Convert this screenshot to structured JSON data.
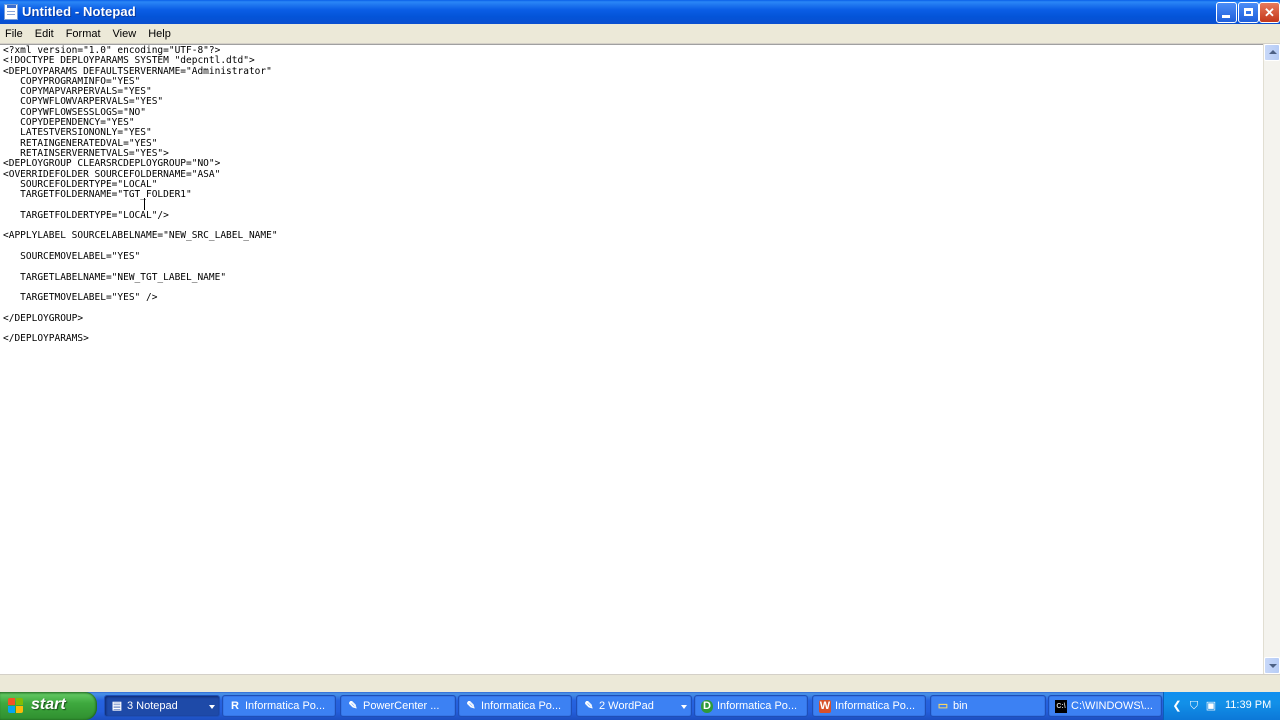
{
  "window": {
    "title": "Untitled - Notepad",
    "controls": {
      "minimize": "minimize",
      "maximize": "maximize",
      "close": "✕"
    }
  },
  "menu": [
    "File",
    "Edit",
    "Format",
    "View",
    "Help"
  ],
  "document": {
    "lines": [
      "<?xml version=\"1.0\" encoding=\"UTF-8\"?>",
      "<!DOCTYPE DEPLOYPARAMS SYSTEM \"depcntl.dtd\">",
      "<DEPLOYPARAMS DEFAULTSERVERNAME=\"Administrator\"",
      "   COPYPROGRAMINFO=\"YES\"",
      "   COPYMAPVARPERVALS=\"YES\"",
      "   COPYWFLOWVARPERVALS=\"YES\"",
      "   COPYWFLOWSESSLOGS=\"NO\"",
      "   COPYDEPENDENCY=\"YES\"",
      "   LATESTVERSIONONLY=\"YES\"",
      "   RETAINGENERATEDVAL=\"YES\"",
      "   RETAINSERVERNETVALS=\"YES\">",
      "<DEPLOYGROUP CLEARSRCDEPLOYGROUP=\"NO\">",
      "<OVERRIDEFOLDER SOURCEFOLDERNAME=\"ASA\"",
      "   SOURCEFOLDERTYPE=\"LOCAL\"",
      "   TARGETFOLDERNAME=\"TGT_FOLDER1\"",
      "",
      "   TARGETFOLDERTYPE=\"LOCAL\"/>",
      "",
      "<APPLYLABEL SOURCELABELNAME=\"NEW_SRC_LABEL_NAME\"",
      "",
      "   SOURCEMOVELABEL=\"YES\"",
      "",
      "   TARGETLABELNAME=\"NEW_TGT_LABEL_NAME\"",
      "",
      "   TARGETMOVELABEL=\"YES\" />",
      "",
      "</DEPLOYGROUP>",
      "",
      "</DEPLOYPARAMS>"
    ]
  },
  "taskbar": {
    "start_label": "start",
    "tasks": [
      {
        "label": "3 Notepad",
        "icon": "notepad-icon",
        "glyph": "▤",
        "active": true,
        "has_dropdown": true
      },
      {
        "label": "Informatica Po...",
        "icon": "informatica-r-icon",
        "glyph": "R",
        "active": false,
        "has_dropdown": false
      },
      {
        "label": "PowerCenter ...",
        "icon": "powercenter-icon",
        "glyph": "✎",
        "active": false,
        "has_dropdown": false
      },
      {
        "label": "Informatica Po...",
        "icon": "informatica-doc-icon",
        "glyph": "✎",
        "active": false,
        "has_dropdown": false
      },
      {
        "label": "2 WordPad",
        "icon": "wordpad-icon",
        "glyph": "✎",
        "active": false,
        "has_dropdown": true
      },
      {
        "label": "Informatica Po...",
        "icon": "informatica-d-icon",
        "glyph": "D",
        "active": false,
        "has_dropdown": false
      },
      {
        "label": "Informatica Po...",
        "icon": "informatica-w-icon",
        "glyph": "W",
        "active": false,
        "has_dropdown": false
      },
      {
        "label": "bin",
        "icon": "folder-icon",
        "glyph": "▭",
        "active": false,
        "has_dropdown": false
      },
      {
        "label": "C:\\WINDOWS\\...",
        "icon": "command-prompt-icon",
        "glyph": "C:\\",
        "active": false,
        "has_dropdown": false
      }
    ],
    "tray": {
      "icons": [
        "network-icon",
        "security-shield-icon",
        "monitor-icon"
      ],
      "clock": "11:39 PM"
    }
  },
  "colors": {
    "title_bar": "#0a5fe8",
    "start_button": "#3ea93e",
    "taskbar": "#245edb",
    "tray": "#1290e8"
  }
}
